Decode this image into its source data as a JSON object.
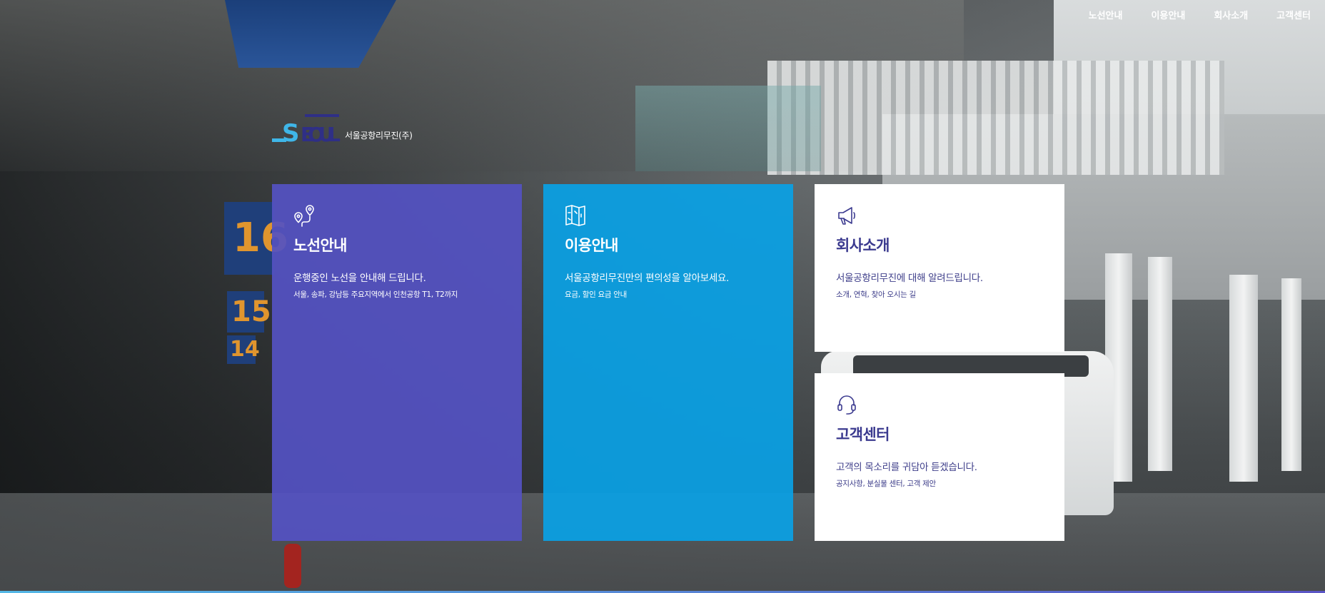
{
  "nav": {
    "items": [
      {
        "label": "노선안내"
      },
      {
        "label": "이용안내"
      },
      {
        "label": "회사소개"
      },
      {
        "label": "고객센터"
      }
    ]
  },
  "logo": {
    "mark_text": "SEOUL",
    "company_name": "서울공항리무진(주)"
  },
  "cards": [
    {
      "icon": "map-pin-route-icon",
      "title": "노선안내",
      "description": "운행중인 노선을 안내해 드립니다.",
      "sub": "서울, 송파, 강남등 주요지역에서 인천공항 T1, T2까지",
      "color": "#5452c2"
    },
    {
      "icon": "map-guide-icon",
      "title": "이용안내",
      "description": "서울공항리무진만의 편의성을 알아보세요.",
      "sub": "요금, 할인 요금 안내",
      "color": "#0aa0e4"
    },
    {
      "icon": "megaphone-icon",
      "title": "회사소개",
      "description": "서울공항리무진에 대해 알려드립니다.",
      "sub": "소개, 연혁, 찾아 오시는 길",
      "color": "#ffffff"
    },
    {
      "icon": "headset-icon",
      "title": "고객센터",
      "description": "고객의 목소리를 귀담아 듣겠습니다.",
      "sub": "공지사항, 분실물 센터, 고객 제안",
      "color": "#ffffff"
    }
  ],
  "colors": {
    "primary_purple": "#5452c2",
    "primary_blue": "#0aa0e4",
    "title_navy": "#3b3a8f",
    "logo_cyan": "#3fb6e8",
    "logo_navy": "#2f2f86"
  }
}
